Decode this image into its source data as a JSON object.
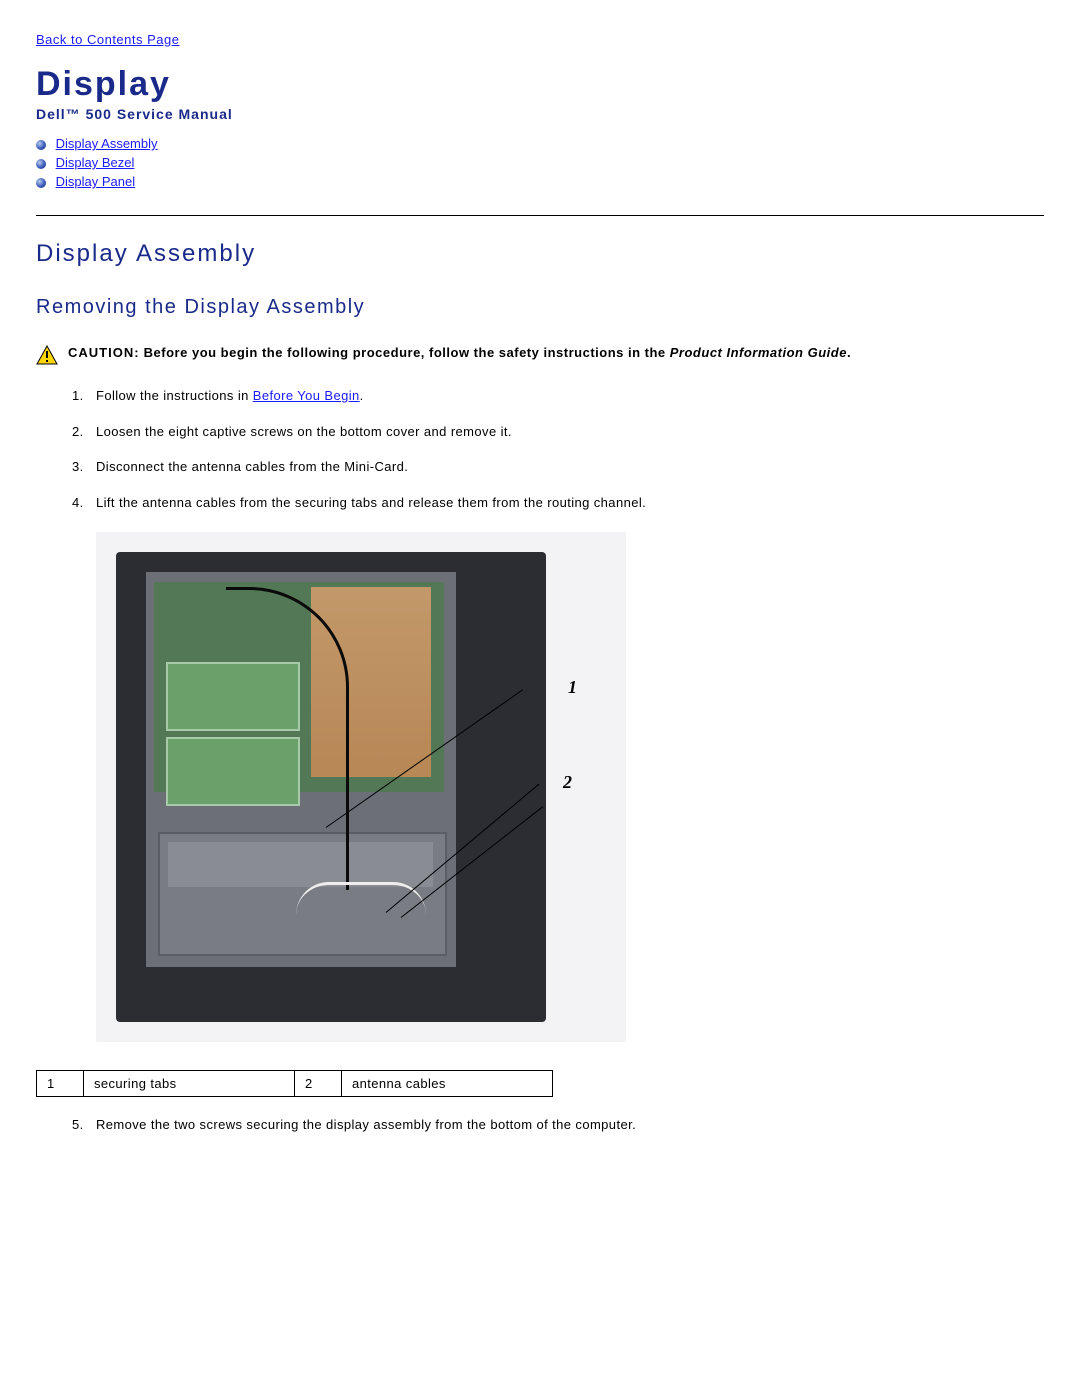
{
  "top_link": "Back to Contents Page",
  "page_title": "Display",
  "subtitle": "Dell™ 500 Service Manual",
  "nav": [
    "Display Assembly",
    "Display Bezel",
    "Display Panel"
  ],
  "section_heading": "Display Assembly",
  "subsection_heading": "Removing the Display Assembly",
  "caution": {
    "label": "CAUTION:",
    "text_before_italic": "Before you begin the following procedure, follow the safety instructions in the ",
    "italic": "Product Information Guide",
    "after": "."
  },
  "steps_a": [
    {
      "pre": "Follow the instructions in ",
      "link": "Before You Begin",
      "post": "."
    },
    {
      "text": "Loosen the eight captive screws on the bottom cover and remove it."
    },
    {
      "text": "Disconnect the antenna cables from the Mini-Card."
    },
    {
      "text": "Lift the antenna cables from the securing tabs and release them from the routing channel."
    }
  ],
  "callouts": {
    "1": "1",
    "2": "2"
  },
  "callout_table": [
    {
      "num": "1",
      "label": "securing tabs"
    },
    {
      "num": "2",
      "label": "antenna cables"
    }
  ],
  "step5": "Remove the two screws securing the display assembly from the bottom of the computer."
}
